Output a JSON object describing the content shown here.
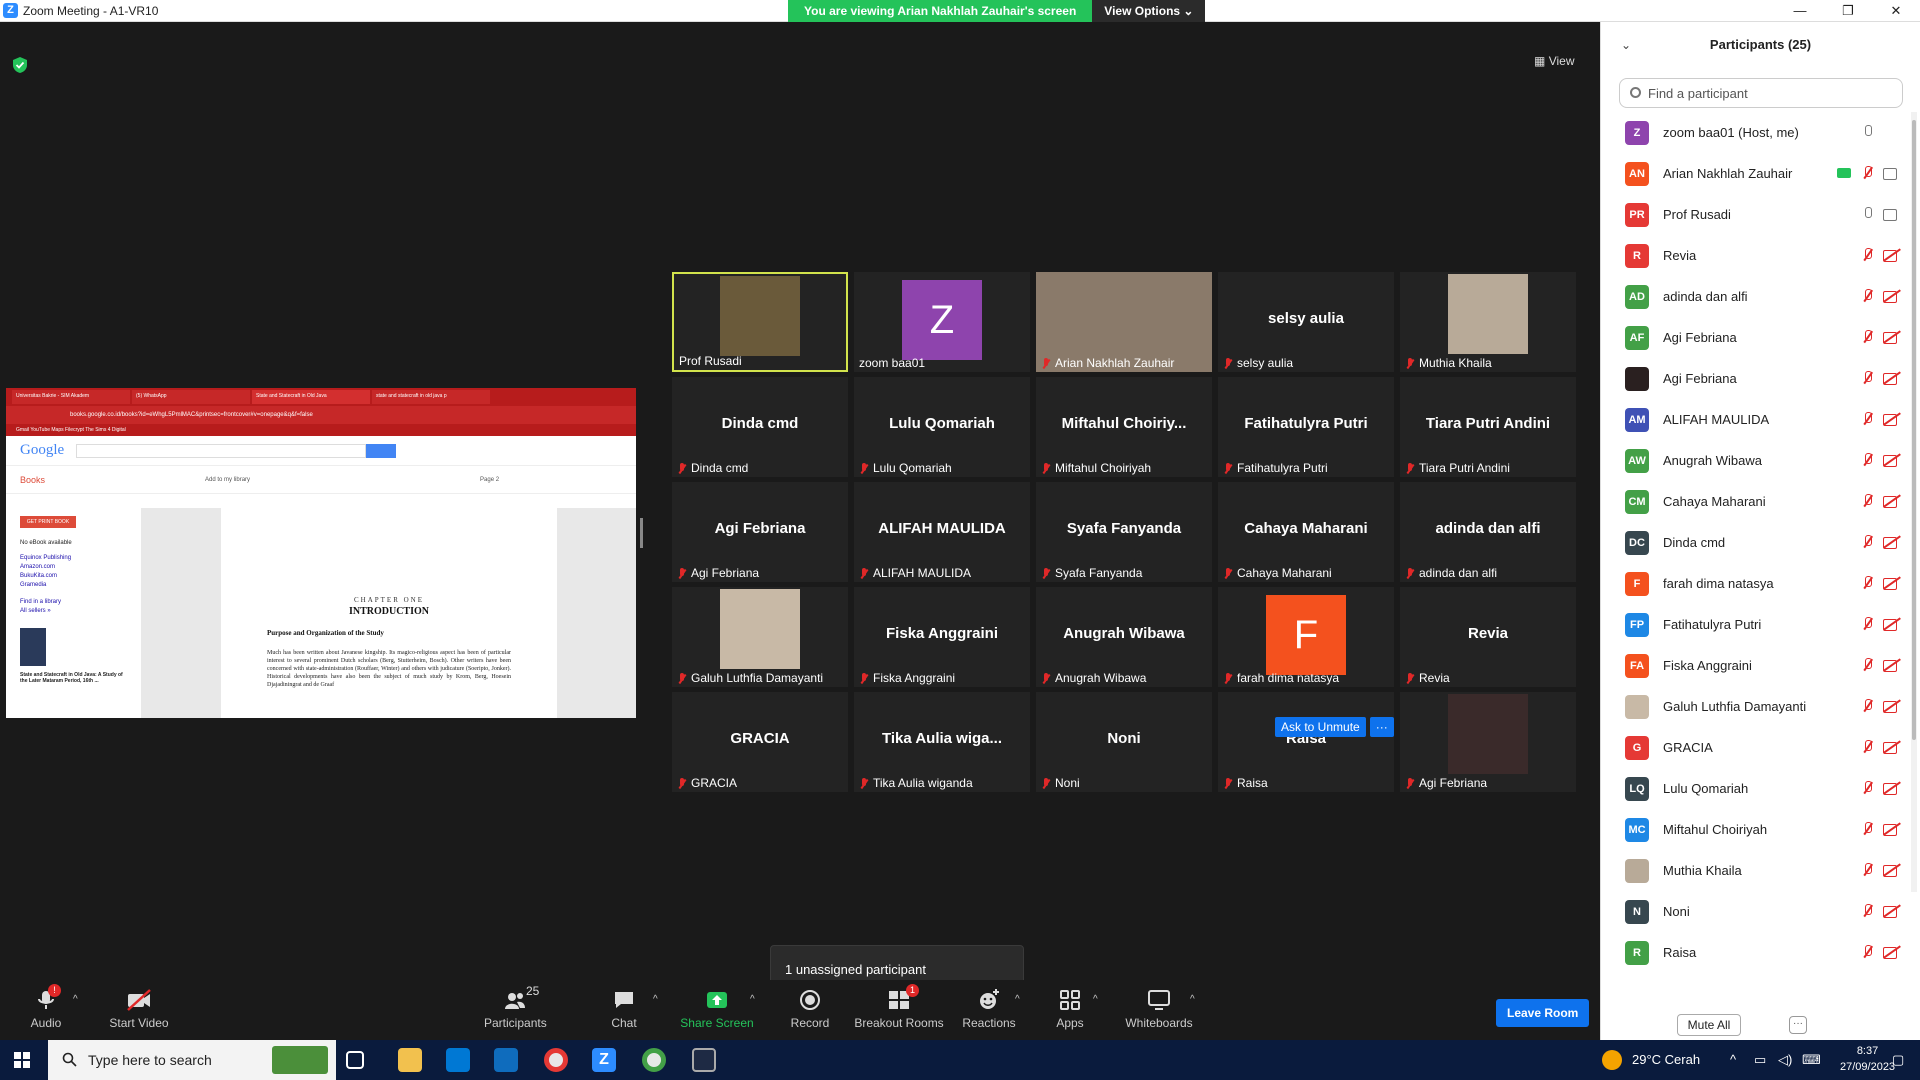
{
  "window": {
    "title": "Zoom Meeting - A1-VR10",
    "logo_letter": "Z"
  },
  "banner": {
    "message": "You are viewing Arian Nakhlah Zauhair's screen",
    "options": "View Options"
  },
  "view_label": "View",
  "shared_screen": {
    "tabs": [
      "Universitas Bakrie - SIM Akadem",
      "(5) WhatsApp",
      "State and Statecraft in Old Java",
      "state and statecraft in old java p"
    ],
    "url": "books.google.co.id/books?id=eWhgL5PmlMAC&printsec=frontcover#v=onepage&q&f=false",
    "bookmarks": "Gmail   YouTube   Maps   Filecrypt   The Sims 4 Digital",
    "google_logo": "Google",
    "books_label": "Books",
    "add_library": "Add to my library",
    "page_label": "Page 2",
    "get_print": "GET PRINT BOOK",
    "no_ebook": "No eBook available",
    "sellers": [
      "Equinox Publishing",
      "Amazon.com",
      "BukuKita.com",
      "Gramedia"
    ],
    "find_library": "Find in a library",
    "all_sellers": "All sellers »",
    "book_title_small": "State and Statecraft in Old Java: A Study of the Later Mataram Period, 16th ...",
    "chapter": "CHAPTER ONE",
    "intro": "INTRODUCTION",
    "subtitle": "Purpose and Organization of the Study",
    "body_text": "Much has been written about Javanese kingship. Its magico-religious aspect has been of particular interest to several prominent Dutch scholars (Berg, Stutterheim, Bosch). Other writers have been concerned with state-administration (Rouffaer, Winter) and others with judicature (Soeripto, Jonker). Historical developments have also been the subject of much study by Krom, Berg, Hoesein Djajadiningrat and de Graaf"
  },
  "tiles": [
    {
      "big": "",
      "name": "Prof Rusadi",
      "muted": false,
      "type": "photo",
      "color": "#6a5a3a"
    },
    {
      "big": "",
      "name": "zoom baa01",
      "muted": false,
      "type": "avatar",
      "letter": "Z",
      "color": "#8e44ad"
    },
    {
      "big": "",
      "name": "Arian Nakhlah Zauhair",
      "muted": true,
      "type": "photo",
      "color": "#8a7a6a"
    },
    {
      "big": "selsy aulia",
      "name": "selsy aulia",
      "muted": true,
      "type": "name"
    },
    {
      "big": "",
      "name": "Muthia Khaila",
      "muted": true,
      "type": "photo",
      "color": "#b8aa98"
    },
    {
      "big": "Dinda cmd",
      "name": "Dinda cmd",
      "muted": true,
      "type": "name"
    },
    {
      "big": "Lulu  Qomariah",
      "name": "Lulu  Qomariah",
      "muted": true,
      "type": "name"
    },
    {
      "big": "Miftahul  Choiriy...",
      "name": "Miftahul Choiriyah",
      "muted": true,
      "type": "name"
    },
    {
      "big": "Fatihatulyra Putri",
      "name": "Fatihatulyra Putri",
      "muted": true,
      "type": "name"
    },
    {
      "big": "Tiara Putri Andini",
      "name": "Tiara Putri Andini",
      "muted": true,
      "type": "name"
    },
    {
      "big": "Agi Febriana",
      "name": "Agi Febriana",
      "muted": true,
      "type": "name"
    },
    {
      "big": "ALIFAH MAULIDA",
      "name": "ALIFAH MAULIDA",
      "muted": true,
      "type": "name"
    },
    {
      "big": "Syafa Fanyanda",
      "name": "Syafa Fanyanda",
      "muted": true,
      "type": "name"
    },
    {
      "big": "Cahaya Maharani",
      "name": "Cahaya Maharani",
      "muted": true,
      "type": "name"
    },
    {
      "big": "adinda dan alfi",
      "name": "adinda dan alfi",
      "muted": true,
      "type": "name"
    },
    {
      "big": "",
      "name": "Galuh Luthfia Damayanti",
      "muted": true,
      "type": "photo",
      "color": "#c8b9a6"
    },
    {
      "big": "Fiska Anggraini",
      "name": "Fiska Anggraini",
      "muted": true,
      "type": "name"
    },
    {
      "big": "Anugrah Wibawa",
      "name": "Anugrah Wibawa",
      "muted": true,
      "type": "name"
    },
    {
      "big": "",
      "name": "farah dima natasya",
      "muted": true,
      "type": "avatar",
      "letter": "F",
      "color": "#f4511e"
    },
    {
      "big": "Revia",
      "name": "Revia",
      "muted": true,
      "type": "name"
    },
    {
      "big": "GRACIA",
      "name": "GRACIA",
      "muted": true,
      "type": "name"
    },
    {
      "big": "Tika  Aulia  wiga...",
      "name": "Tika Aulia wiganda",
      "muted": true,
      "type": "name"
    },
    {
      "big": "Noni",
      "name": "Noni",
      "muted": true,
      "type": "name"
    },
    {
      "big": "Raisa",
      "name": "Raisa",
      "muted": true,
      "type": "name"
    },
    {
      "big": "",
      "name": "Agi Febriana",
      "muted": true,
      "type": "photo",
      "color": "#3a2a2a"
    }
  ],
  "ask_to_unmute": "Ask to Unmute",
  "tile_more": "···",
  "unassigned": "1 unassigned participant",
  "toolbar": {
    "audio": "Audio",
    "audio_badge": "!",
    "start_video": "Start Video",
    "participants": "Participants",
    "participants_count": "25",
    "chat": "Chat",
    "share_screen": "Share Screen",
    "record": "Record",
    "breakout": "Breakout Rooms",
    "breakout_badge": "1",
    "reactions": "Reactions",
    "apps": "Apps",
    "whiteboards": "Whiteboards",
    "leave": "Leave Room"
  },
  "panel": {
    "title": "Participants (25)",
    "search_placeholder": "Find a participant",
    "mute_all": "Mute All",
    "more": "···",
    "participants": [
      {
        "initials": "Z",
        "name": "zoom baa01 (Host, me)",
        "color": "#8e44ad",
        "mic": "on",
        "cam": "none",
        "share": false
      },
      {
        "initials": "AN",
        "name": "Arian Nakhlah Zauhair",
        "color": "#f4511e",
        "mic": "off",
        "cam": "on",
        "share": true
      },
      {
        "initials": "PR",
        "name": "Prof Rusadi",
        "color": "#e53935",
        "mic": "on",
        "cam": "on",
        "share": false
      },
      {
        "initials": "R",
        "name": " Revia",
        "color": "#e53935",
        "mic": "off",
        "cam": "off",
        "share": false
      },
      {
        "initials": "AD",
        "name": "adinda dan alfi",
        "color": "#43a047",
        "mic": "off",
        "cam": "off",
        "share": false
      },
      {
        "initials": "AF",
        "name": "Agi Febriana",
        "color": "#43a047",
        "mic": "off",
        "cam": "off",
        "share": false
      },
      {
        "initials": "",
        "name": "Agi Febriana",
        "color": "#2a2020",
        "mic": "off",
        "cam": "off",
        "share": false
      },
      {
        "initials": "AM",
        "name": "ALIFAH MAULIDA",
        "color": "#3f51b5",
        "mic": "off",
        "cam": "off",
        "share": false
      },
      {
        "initials": "AW",
        "name": "Anugrah Wibawa",
        "color": "#43a047",
        "mic": "off",
        "cam": "off",
        "share": false
      },
      {
        "initials": "CM",
        "name": "Cahaya Maharani",
        "color": "#43a047",
        "mic": "off",
        "cam": "off",
        "share": false
      },
      {
        "initials": "DC",
        "name": "Dinda cmd",
        "color": "#37474f",
        "mic": "off",
        "cam": "off",
        "share": false
      },
      {
        "initials": "F",
        "name": "farah dima natasya",
        "color": "#f4511e",
        "mic": "off",
        "cam": "off",
        "share": false
      },
      {
        "initials": "FP",
        "name": "Fatihatulyra Putri",
        "color": "#1e88e5",
        "mic": "off",
        "cam": "off",
        "share": false
      },
      {
        "initials": "FA",
        "name": "Fiska Anggraini",
        "color": "#f4511e",
        "mic": "off",
        "cam": "off",
        "share": false
      },
      {
        "initials": "",
        "name": "Galuh Luthfia Damayanti",
        "color": "#c8b9a6",
        "mic": "off",
        "cam": "off",
        "share": false
      },
      {
        "initials": "G",
        "name": "GRACIA",
        "color": "#e53935",
        "mic": "off",
        "cam": "off",
        "share": false
      },
      {
        "initials": "LQ",
        "name": "Lulu  Qomariah",
        "color": "#37474f",
        "mic": "off",
        "cam": "off",
        "share": false
      },
      {
        "initials": "MC",
        "name": "Miftahul Choiriyah",
        "color": "#1e88e5",
        "mic": "off",
        "cam": "off",
        "share": false
      },
      {
        "initials": "",
        "name": "Muthia Khaila",
        "color": "#b8aa98",
        "mic": "off",
        "cam": "off",
        "share": false
      },
      {
        "initials": "N",
        "name": "Noni",
        "color": "#37474f",
        "mic": "off",
        "cam": "off",
        "share": false
      },
      {
        "initials": "R",
        "name": "Raisa",
        "color": "#43a047",
        "mic": "off",
        "cam": "off",
        "share": false
      }
    ]
  },
  "taskbar": {
    "search_placeholder": "Type here to search",
    "weather": "29°C  Cerah",
    "time": "8:37",
    "date": "27/09/2023"
  }
}
